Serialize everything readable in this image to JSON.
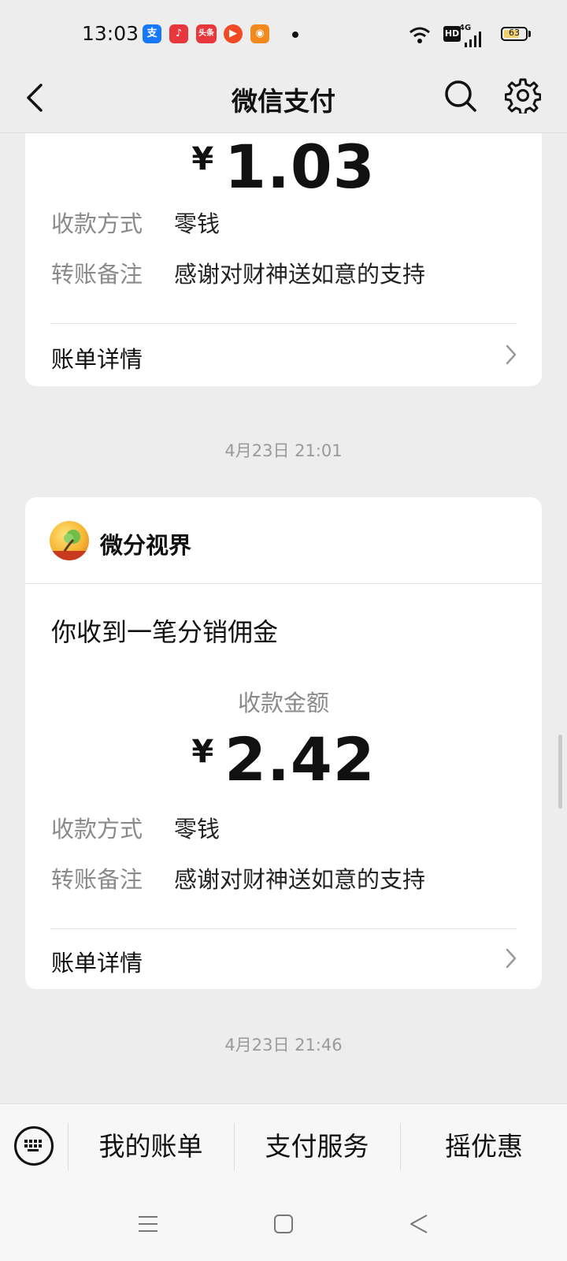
{
  "status_bar": {
    "time": "13:03",
    "apps": [
      {
        "icon": "alipay-icon",
        "label": "支",
        "color": "#1677ff"
      },
      {
        "icon": "music-icon",
        "label": "♪",
        "color": "#e8363d"
      },
      {
        "icon": "toutiao-icon",
        "label": "头条",
        "color": "#e8363d"
      },
      {
        "icon": "video-icon",
        "label": "▶",
        "color": "#f04b24"
      },
      {
        "icon": "app-icon",
        "label": "◉",
        "color": "#f08a1c"
      }
    ],
    "hd": "HD",
    "network": "4G",
    "battery": "63"
  },
  "nav": {
    "title": "微信支付"
  },
  "cards": [
    {
      "amount_symbol": "¥",
      "amount": "1.03",
      "method_label": "收款方式",
      "method_value": "零钱",
      "note_label": "转账备注",
      "note_value": "感谢对财神送如意的支持",
      "details_label": "账单详情"
    },
    {
      "merchant": "微分视界",
      "title": "你收到一笔分销佣金",
      "amount_label": "收款金额",
      "amount_symbol": "¥",
      "amount": "2.42",
      "method_label": "收款方式",
      "method_value": "零钱",
      "note_label": "转账备注",
      "note_value": "感谢对财神送如意的支持",
      "details_label": "账单详情"
    }
  ],
  "timestamps": [
    "4月23日 21:01",
    "4月23日 21:46"
  ],
  "bottom_menu": {
    "items": [
      "我的账单",
      "支付服务",
      "摇优惠"
    ]
  },
  "colors": {
    "background": "#ededed",
    "card": "#ffffff",
    "muted_text": "#8a8a8a"
  }
}
